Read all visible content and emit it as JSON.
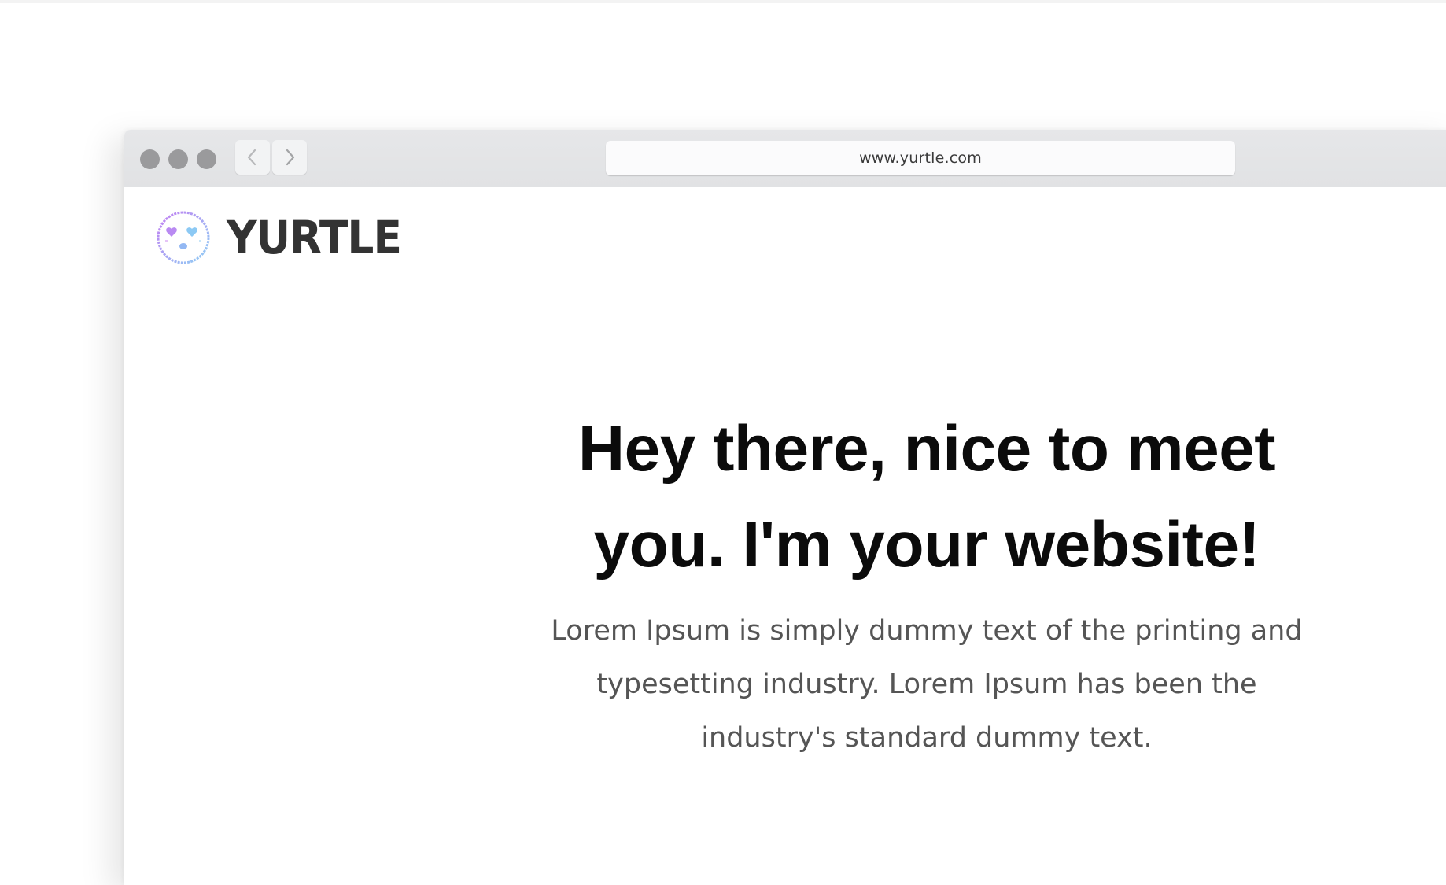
{
  "browser": {
    "url": "www.yurtle.com",
    "controls": {
      "close_dot": "traffic-light-close",
      "minimize_dot": "traffic-light-minimize",
      "maximize_dot": "traffic-light-maximize",
      "back_icon": "chevron-left-icon",
      "forward_icon": "chevron-right-icon"
    },
    "colors": {
      "chrome": "#e3e4e6",
      "dot": "#9a9a9c",
      "url_bar": "#fbfbfc"
    }
  },
  "site": {
    "logo": {
      "icon": "yurtle-heart-eyes-face-icon",
      "text": "YURTLE",
      "colors": {
        "outline_start": "#c27cf2",
        "outline_end": "#8fd0f5",
        "text": "#333333"
      }
    },
    "hero": {
      "title": "Hey there, nice to meet you. I'm your website!",
      "description": "Lorem Ipsum is simply dummy text of the printing and typesetting industry. Lorem Ipsum has been the industry's standard dummy text."
    }
  }
}
